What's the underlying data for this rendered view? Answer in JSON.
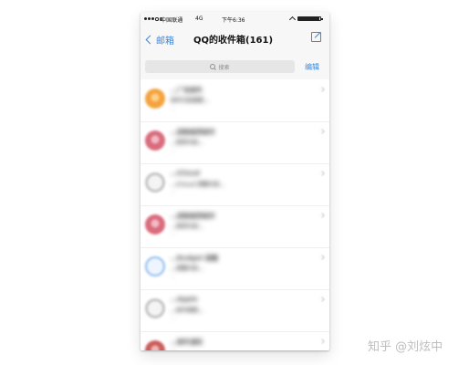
{
  "status_bar": {
    "carrier": "中国联通",
    "network": "4G",
    "time": "下午6:36",
    "battery_level": 0.95
  },
  "nav": {
    "back_label": "邮箱",
    "title": "QQ的收件箱(161)"
  },
  "search": {
    "placeholder": "搜索",
    "edit_label": "编辑"
  },
  "messages": [
    {
      "sender": "…广告邮件",
      "subject": "邮件内容摘要…",
      "preview": "…",
      "time": "…",
      "avatar_style": "solid",
      "avatar_color": "#f39a2c",
      "avatar_inner_color": "#ffcc7a"
    },
    {
      "sender": "…团购推荐邮件",
      "subject": "…推荐内容…",
      "preview": "…",
      "time": "…",
      "avatar_style": "solid",
      "avatar_color": "#d65d6f",
      "avatar_inner_color": "#f2b3bf"
    },
    {
      "sender": "…iCloud",
      "subject": "…iCloud 提醒内容…",
      "preview": "…",
      "time": "…",
      "avatar_style": "ring",
      "avatar_color": "#bdbdbd",
      "avatar_inner_color": "#f3f3f3"
    },
    {
      "sender": "…团购推荐邮件",
      "subject": "…推荐内容…",
      "preview": "…",
      "time": "…",
      "avatar_style": "solid",
      "avatar_color": "#d65d6f",
      "avatar_inner_color": "#f2b3bf"
    },
    {
      "sender": "…Budget 提醒",
      "subject": "…提醒内容…",
      "preview": "…",
      "time": "…",
      "avatar_style": "ring-blue",
      "avatar_color": "#7fb2ee",
      "avatar_inner_color": "#eef5ff"
    },
    {
      "sender": "…Apple",
      "subject": "…邮件摘要…",
      "preview": "…",
      "time": "…",
      "avatar_style": "ring",
      "avatar_color": "#bdbdbd",
      "avatar_inner_color": "#f3f3f3"
    },
    {
      "sender": "…邮件通知",
      "subject": "…",
      "preview": "",
      "time": "",
      "avatar_style": "solid",
      "avatar_color": "#c84a4a",
      "avatar_inner_color": "#efb0b0"
    }
  ],
  "watermark": "知乎 @刘炫中"
}
